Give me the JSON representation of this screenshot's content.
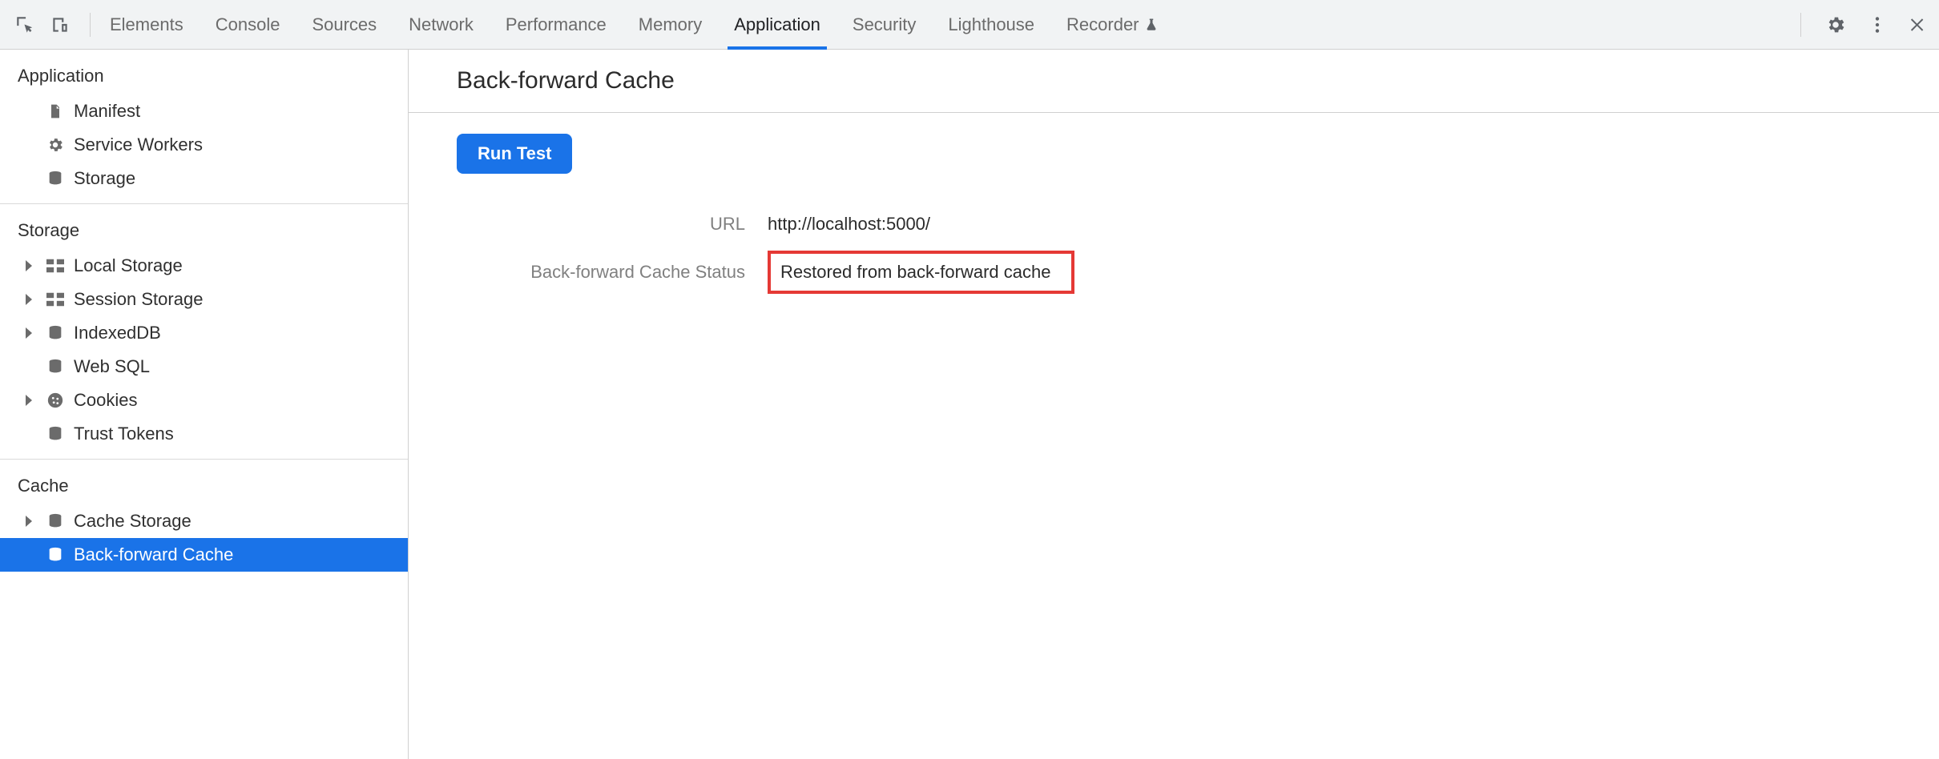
{
  "tabs": [
    {
      "label": "Elements"
    },
    {
      "label": "Console"
    },
    {
      "label": "Sources"
    },
    {
      "label": "Network"
    },
    {
      "label": "Performance"
    },
    {
      "label": "Memory"
    },
    {
      "label": "Application",
      "active": true
    },
    {
      "label": "Security"
    },
    {
      "label": "Lighthouse"
    },
    {
      "label": "Recorder"
    }
  ],
  "sidebar": {
    "sections": [
      {
        "title": "Application",
        "items": [
          {
            "label": "Manifest",
            "icon": "file",
            "expandable": false
          },
          {
            "label": "Service Workers",
            "icon": "gear",
            "expandable": false
          },
          {
            "label": "Storage",
            "icon": "db",
            "expandable": false
          }
        ]
      },
      {
        "title": "Storage",
        "items": [
          {
            "label": "Local Storage",
            "icon": "grid",
            "expandable": true
          },
          {
            "label": "Session Storage",
            "icon": "grid",
            "expandable": true
          },
          {
            "label": "IndexedDB",
            "icon": "db",
            "expandable": true
          },
          {
            "label": "Web SQL",
            "icon": "db",
            "expandable": false
          },
          {
            "label": "Cookies",
            "icon": "cookie",
            "expandable": true
          },
          {
            "label": "Trust Tokens",
            "icon": "db",
            "expandable": false
          }
        ]
      },
      {
        "title": "Cache",
        "items": [
          {
            "label": "Cache Storage",
            "icon": "db",
            "expandable": true
          },
          {
            "label": "Back-forward Cache",
            "icon": "db",
            "expandable": false,
            "selected": true
          }
        ]
      }
    ]
  },
  "content": {
    "title": "Back-forward Cache",
    "run_button": "Run Test",
    "rows": {
      "url_label": "URL",
      "url_value": "http://localhost:5000/",
      "status_label": "Back-forward Cache Status",
      "status_value": "Restored from back-forward cache"
    }
  }
}
